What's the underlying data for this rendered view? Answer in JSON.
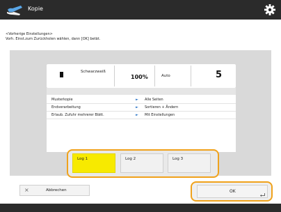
{
  "header": {
    "title": "Kopie",
    "app_icon": "copy-icon",
    "settings_icon": "gear-icon"
  },
  "instructions": {
    "line1": "<Vorherige Einstellungen>",
    "line2": "Vorh. Einst.zum Zurückholen wählen, dann [OK] betät."
  },
  "status": {
    "color_mode": "Schwarzweiß",
    "zoom": "100%",
    "paper": "Auto",
    "copies": "5"
  },
  "settings_list": [
    {
      "label": "Musterkopie",
      "arrow": "►",
      "value": "Alle Seiten"
    },
    {
      "label": "Endverarbeitung",
      "arrow": "►",
      "value": "Sortieren + Ändern"
    },
    {
      "label": "Erlaub. Zufuhr mehrerer Blätt.",
      "arrow": "►",
      "value": "Mit Einstellungen"
    }
  ],
  "logs": [
    {
      "label": "Log 1",
      "selected": true
    },
    {
      "label": "Log 2",
      "selected": false
    },
    {
      "label": "Log 3",
      "selected": false
    }
  ],
  "footer": {
    "cancel_icon": "close-icon",
    "cancel_label": "Abbrechen",
    "ok_label": "OK",
    "ok_icon": "enter-icon"
  },
  "colors": {
    "accent": "#f0a21b",
    "selected": "#f7ea00",
    "bar": "#2b2b2b"
  }
}
